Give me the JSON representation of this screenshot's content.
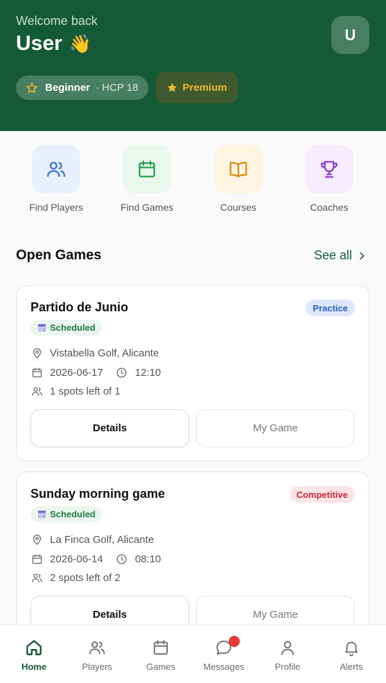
{
  "header": {
    "welcome": "Welcome back",
    "username": "User",
    "wave_emoji": "👋",
    "avatar_initial": "U",
    "level": "Beginner",
    "handicap": "· HCP 18",
    "premium": "Premium",
    "bg_color": "#155a38"
  },
  "quick_actions": [
    {
      "label": "Find Players",
      "icon": "players-icon",
      "color": "#3b6fd8"
    },
    {
      "label": "Find Games",
      "icon": "calendar-icon",
      "color": "#22a04b"
    },
    {
      "label": "Courses",
      "icon": "book-icon",
      "color": "#d98a12"
    },
    {
      "label": "Coaches",
      "icon": "trophy-icon",
      "color": "#8b3ad6"
    }
  ],
  "open_games": {
    "title": "Open Games",
    "see_all": "See all",
    "games": [
      {
        "title": "Partido de Junio",
        "type": "Practice",
        "status": "Scheduled",
        "location": "Vistabella Golf, Alicante",
        "date": "2026-06-17",
        "time": "12:10",
        "spots": "1 spots left of 1",
        "details_label": "Details",
        "mygame_label": "My Game"
      },
      {
        "title": "Sunday morning game",
        "type": "Competitive",
        "status": "Scheduled",
        "location": "La Finca Golf, Alicante",
        "date": "2026-06-14",
        "time": "08:10",
        "spots": "2 spots left of 2",
        "details_label": "Details",
        "mygame_label": "My Game"
      }
    ]
  },
  "bottom_nav": [
    {
      "label": "Home",
      "icon": "home-icon",
      "active": true
    },
    {
      "label": "Players",
      "icon": "players-icon"
    },
    {
      "label": "Games",
      "icon": "calendar-icon"
    },
    {
      "label": "Messages",
      "icon": "message-icon",
      "badge": true
    },
    {
      "label": "Profile",
      "icon": "profile-icon"
    },
    {
      "label": "Alerts",
      "icon": "bell-icon"
    }
  ]
}
